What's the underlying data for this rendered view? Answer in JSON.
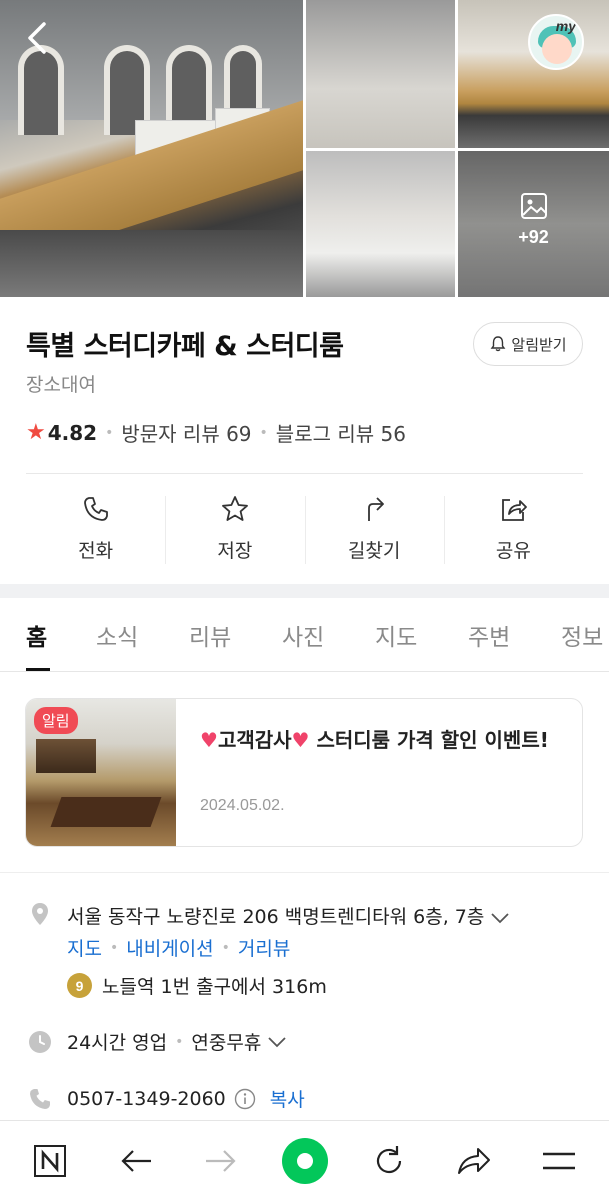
{
  "gallery": {
    "more_count": "+92"
  },
  "avatar": {
    "label": "my"
  },
  "place": {
    "name": "특별 스터디카페 & 스터디룸",
    "category": "장소대여",
    "rating": "4.82",
    "visitor_reviews": "방문자 리뷰 69",
    "blog_reviews": "블로그 리뷰 56",
    "alarm_label": "알림받기"
  },
  "actions": [
    {
      "label": "전화",
      "icon": "phone-icon"
    },
    {
      "label": "저장",
      "icon": "star-icon"
    },
    {
      "label": "길찾기",
      "icon": "directions-icon"
    },
    {
      "label": "공유",
      "icon": "share-icon"
    }
  ],
  "tabs": [
    "홈",
    "소식",
    "리뷰",
    "사진",
    "지도",
    "주변",
    "정보"
  ],
  "notice": {
    "badge": "알림",
    "title_text": "고객감사",
    "title_rest": " 스터디룸 가격 할인 이벤트!",
    "date": "2024.05.02."
  },
  "info": {
    "address": "서울 동작구 노량진로 206 백명트렌디타워 6층, 7층",
    "links": [
      "지도",
      "내비게이션",
      "거리뷰"
    ],
    "subway_line": "9",
    "subway_text": "노들역 1번 출구에서 316m",
    "hours": "24시간 영업",
    "holiday": "연중무휴",
    "phone": "0507-1349-2060",
    "copy_label": "복사"
  },
  "colors": {
    "accent_red": "#f04b41",
    "link_blue": "#1a6fd1",
    "naver_green": "#03c75a",
    "line9": "#c7a23a"
  }
}
